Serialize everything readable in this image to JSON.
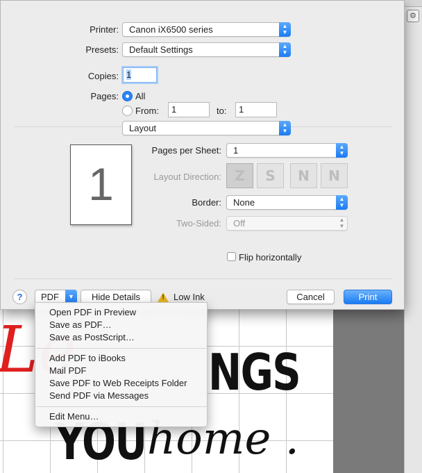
{
  "print_dialog": {
    "printer": {
      "label": "Printer:",
      "value": "Canon iX6500 series"
    },
    "presets": {
      "label": "Presets:",
      "value": "Default Settings"
    },
    "copies": {
      "label": "Copies:",
      "value": "1"
    },
    "pages": {
      "label": "Pages:",
      "all_label": "All",
      "from_label": "From:",
      "from_value": "1",
      "to_label": "to:",
      "to_value": "1",
      "selected": "All"
    },
    "section_popup": {
      "value": "Layout"
    },
    "preview_page_number": "1",
    "layout": {
      "pages_per_sheet": {
        "label": "Pages per Sheet:",
        "value": "1"
      },
      "layout_direction": {
        "label": "Layout Direction:",
        "options": [
          "Z",
          "S",
          "N",
          "N"
        ],
        "selected_index": 0
      },
      "border": {
        "label": "Border:",
        "value": "None"
      },
      "two_sided": {
        "label": "Two-Sided:",
        "value": "Off"
      },
      "flip_horizontally": {
        "label": "Flip horizontally",
        "checked": false
      }
    },
    "footer": {
      "help_label": "?",
      "pdf_label": "PDF",
      "hide_details_label": "Hide Details",
      "status_label": "Low Ink",
      "cancel_label": "Cancel",
      "print_label": "Print"
    }
  },
  "pdf_menu": {
    "groups": [
      [
        "Open PDF in Preview",
        "Save as PDF…",
        "Save as PostScript…"
      ],
      [
        "Add PDF to iBooks",
        "Mail PDF",
        "Save PDF to Web Receipts Folder",
        "Send PDF via Messages"
      ],
      [
        "Edit Menu…"
      ]
    ]
  },
  "background_document": {
    "text_script": "Le",
    "text_bold_top": "NGS",
    "text_bold_bottom": "YOU",
    "text_hand": "home ."
  },
  "colors": {
    "accent": "#1b7cf4",
    "warning": "#e8b520",
    "script_red": "#e02020"
  },
  "icons": {
    "help": "help-icon",
    "warning": "warning-icon",
    "popup_arrows": "chevron-updown-icon",
    "dropdown": "chevron-down-icon"
  }
}
